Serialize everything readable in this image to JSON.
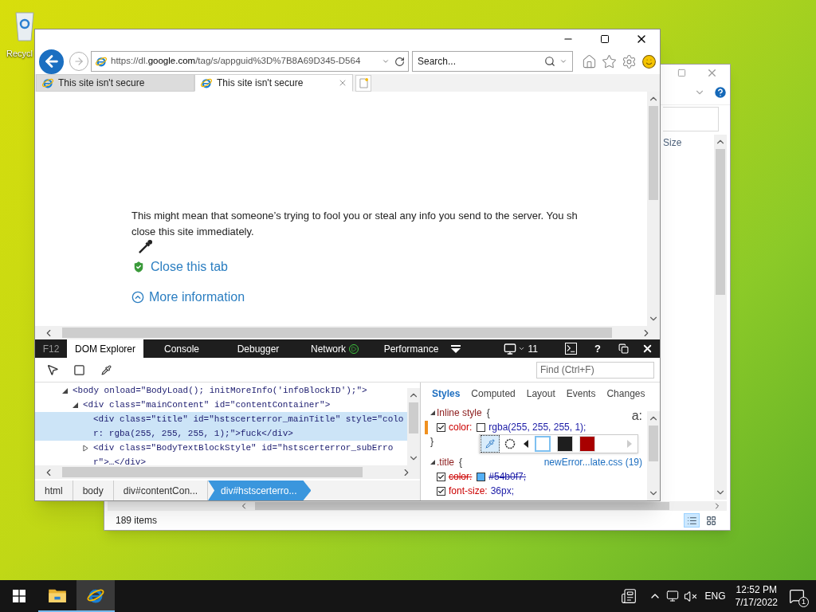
{
  "desktop": {
    "icon_label": "Recycl"
  },
  "explorer": {
    "column_header": "Size",
    "status": "189 items",
    "views": [
      {
        "kind": "details",
        "selected": true
      },
      {
        "kind": "tiles",
        "selected": false
      }
    ]
  },
  "browser": {
    "address": "https://dl.**google.com**/tag/s/appguid%3D%7B8A69D345-D564",
    "search_placeholder": "Search...",
    "tabs": [
      {
        "title": "This site isn't secure",
        "selected": false
      },
      {
        "title": "This site isn't secure",
        "selected": true
      }
    ],
    "page": {
      "lines": [
        "This might mean that someone’s trying to fool you or steal any info you send to the server. You sh",
        "close this site immediately."
      ],
      "links": [
        {
          "kind": "shield",
          "label": "Close this tab"
        },
        {
          "kind": "expand",
          "label": "More information"
        }
      ]
    }
  },
  "devtools": {
    "label": "F12",
    "tabs": [
      {
        "kind": "plain",
        "label": "DOM Explorer",
        "selected": true
      },
      {
        "kind": "plain",
        "label": "Console",
        "selected": false
      },
      {
        "kind": "plain",
        "label": "Debugger",
        "selected": false
      },
      {
        "kind": "record",
        "label": "Network",
        "selected": false
      },
      {
        "kind": "plain",
        "label": "Performance",
        "selected": false
      }
    ],
    "document_mode": "11",
    "help": "?",
    "find_placeholder": "Find (Ctrl+F)",
    "dom_tree": [
      {
        "text": "<body onload=\"BodyLoad(); initMoreInfo('infoBlockID');\">",
        "expanded": true,
        "selected": false,
        "children": [
          {
            "text": "<div class=\"mainContent\" id=\"contentContainer\">",
            "expanded": true,
            "selected": false,
            "children": [
              {
                "text": "<div class=\"title\" id=\"hstscerterror_mainTitle\" style=\"color: rgba(255, 255, 255, 1);\">fuck</div>",
                "selected": true
              },
              {
                "text": "<div class=\"BodyTextBlockStyle\" id=\"hstscerterror_subError\">…</div>",
                "expanded": false,
                "selected": false
              }
            ]
          }
        ]
      }
    ],
    "breadcrumb": [
      {
        "label": "html",
        "selected": false
      },
      {
        "label": "body",
        "selected": false
      },
      {
        "label": "div#contentCon...",
        "selected": false
      },
      {
        "label": "div#hstscerterro...",
        "selected": true
      }
    ],
    "style_tabs": [
      {
        "label": "Styles",
        "selected": true
      },
      {
        "label": "Computed",
        "selected": false
      },
      {
        "label": "Layout",
        "selected": false
      },
      {
        "label": "Events",
        "selected": false
      },
      {
        "label": "Changes",
        "selected": false
      }
    ],
    "pseudo_toggle": "a:",
    "rules": [
      {
        "selector": "Inline style",
        "open": "{",
        "close": "}",
        "declarations": [
          {
            "property": "color:",
            "value": "rgba(255, 255, 255, 1);",
            "color": "#ffffff",
            "checked": true,
            "overridden": false,
            "changed": true
          }
        ]
      },
      {
        "selector": ".title",
        "open": "{",
        "source": "newError...late.css (19)",
        "declarations": [
          {
            "property": "color:",
            "value": "#54b0f7;",
            "color": "#54b0f7",
            "checked": true,
            "overridden": true,
            "changed": false
          },
          {
            "property": "font-size:",
            "value": "36px;",
            "checked": true,
            "overridden": false,
            "changed": false
          }
        ]
      }
    ],
    "color_picker": {
      "swatches": [
        {
          "color": "#ffffff",
          "selected": true
        },
        {
          "color": "#1e1e1e",
          "selected": false
        },
        {
          "color": "#a80000",
          "selected": false
        }
      ]
    }
  },
  "taskbar": {
    "apps": [
      {
        "kind": "explorer",
        "selected": false
      },
      {
        "kind": "ie",
        "selected": true
      }
    ],
    "language": "ENG",
    "time": "12:52 PM",
    "date": "7/17/2022",
    "notifications": "1"
  }
}
